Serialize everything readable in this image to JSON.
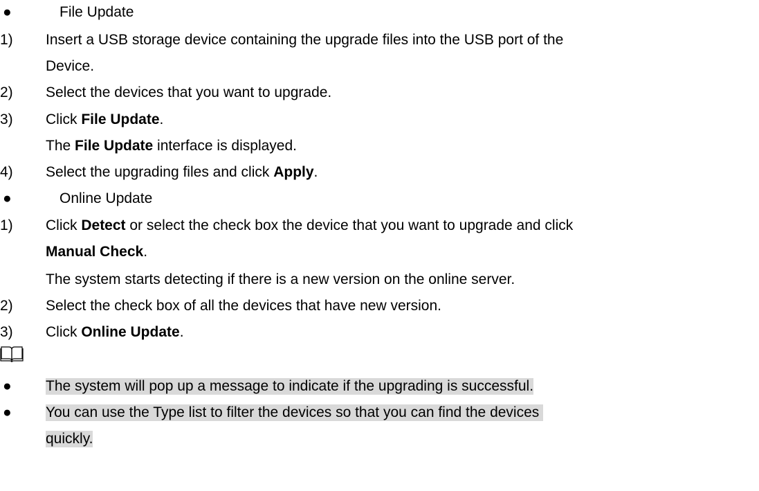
{
  "file_update": {
    "title": "File Update",
    "steps": [
      {
        "num": "1)",
        "line1": "Insert a USB storage device containing the upgrade files into the USB port of the",
        "line2": "Device."
      },
      {
        "num": "2)",
        "text": "Select the devices that you want to upgrade."
      },
      {
        "num": "3)",
        "pre": "Click ",
        "bold": "File Update",
        "post": ".",
        "sub_pre": "The ",
        "sub_bold": "File Update",
        "sub_post": " interface is displayed."
      },
      {
        "num": "4)",
        "pre": "Select the upgrading files and click ",
        "bold": "Apply",
        "post": "."
      }
    ]
  },
  "online_update": {
    "title": "Online Update",
    "steps": [
      {
        "num": "1)",
        "pre": "Click ",
        "bold": "Detect",
        "post": " or select the check box the device that you want to upgrade and click",
        "line2_bold": "Manual Check",
        "line2_post": ".",
        "sub": "The system starts detecting if there is a new version on the online server."
      },
      {
        "num": "2)",
        "text": "Select the check box of all the devices that have new version."
      },
      {
        "num": "3)",
        "pre": "Click ",
        "bold": "Online Update",
        "post": "."
      }
    ]
  },
  "notes": {
    "icon": "book-icon",
    "items": [
      {
        "text": "The system will pop up a message to indicate if the upgrading is successful."
      },
      {
        "line1": "You can use the Type list to filter the devices so that you can find the devices ",
        "line2": "quickly."
      }
    ]
  },
  "bullet": "●"
}
